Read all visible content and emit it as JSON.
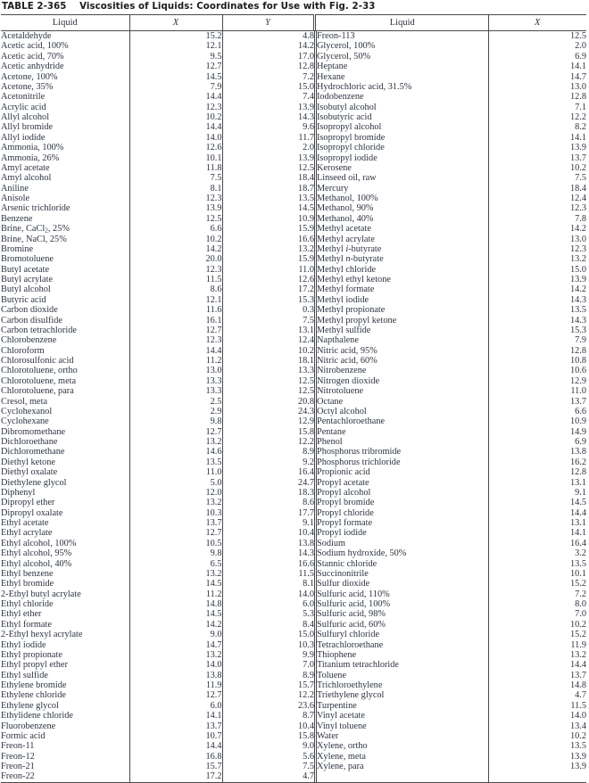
{
  "title": {
    "label": "TABLE 2-365",
    "text": "Viscosities of Liquids: Coordinates for Use with Fig. 2-33"
  },
  "headers": {
    "liquid": "Liquid",
    "x": "X",
    "y": "Y",
    "liquid2": "Liquid",
    "x2": "X"
  },
  "left_rows": [
    {
      "name": "Acetaldehyde",
      "x": "15.2",
      "y": "4.8"
    },
    {
      "name": "Acetic acid, 100%",
      "x": "12.1",
      "y": "14.2"
    },
    {
      "name": "Acetic acid, 70%",
      "x": "9.5",
      "y": "17.0"
    },
    {
      "name": "Acetic anhydride",
      "x": "12.7",
      "y": "12.8"
    },
    {
      "name": "Acetone, 100%",
      "x": "14.5",
      "y": "7.2"
    },
    {
      "name": "Acetone, 35%",
      "x": "7.9",
      "y": "15.0"
    },
    {
      "name": "Acetonitrile",
      "x": "14.4",
      "y": "7.4"
    },
    {
      "name": "Acrylic acid",
      "x": "12.3",
      "y": "13.9"
    },
    {
      "name": "Allyl alcohol",
      "x": "10.2",
      "y": "14.3"
    },
    {
      "name": "Allyl bromide",
      "x": "14.4",
      "y": "9.6"
    },
    {
      "name": "Allyl iodide",
      "x": "14.0",
      "y": "11.7"
    },
    {
      "name": "Ammonia, 100%",
      "x": "12.6",
      "y": "2.0"
    },
    {
      "name": "Ammonia, 26%",
      "x": "10.1",
      "y": "13.9"
    },
    {
      "name": "Amyl acetate",
      "x": "11.8",
      "y": "12.5"
    },
    {
      "name": "Amyl alcohol",
      "x": "7.5",
      "y": "18.4"
    },
    {
      "name": "Aniline",
      "x": "8.1",
      "y": "18.7"
    },
    {
      "name": "Anisole",
      "x": "12.3",
      "y": "13.5"
    },
    {
      "name": "Arsenic trichloride",
      "x": "13.9",
      "y": "14.5"
    },
    {
      "name": "Benzene",
      "x": "12.5",
      "y": "10.9"
    },
    {
      "name": "Brine, CaCl<sub>2</sub>, 25%",
      "html": true,
      "x": "6.6",
      "y": "15.9"
    },
    {
      "name": "Brine, NaCl, 25%",
      "x": "10.2",
      "y": "16.6"
    },
    {
      "name": "Bromine",
      "x": "14.2",
      "y": "13.2"
    },
    {
      "name": "Bromotoluene",
      "x": "20.0",
      "y": "15.9"
    },
    {
      "name": "Butyl acetate",
      "x": "12.3",
      "y": "11.0"
    },
    {
      "name": "Butyl acrylate",
      "x": "11.5",
      "y": "12.6"
    },
    {
      "name": "Butyl alcohol",
      "x": "8.6",
      "y": "17.2"
    },
    {
      "name": "Butyric acid",
      "x": "12.1",
      "y": "15.3"
    },
    {
      "name": "Carbon dioxide",
      "x": "11.6",
      "y": "0.3"
    },
    {
      "name": "Carbon disulfide",
      "x": "16.1",
      "y": "7.5"
    },
    {
      "name": "Carbon tetrachloride",
      "x": "12.7",
      "y": "13.1"
    },
    {
      "name": "Chlorobenzene",
      "x": "12.3",
      "y": "12.4"
    },
    {
      "name": "Chloroform",
      "x": "14.4",
      "y": "10.2"
    },
    {
      "name": "Chlorosulfonic acid",
      "x": "11.2",
      "y": "18.1"
    },
    {
      "name": "Chlorotoluene, ortho",
      "x": "13.0",
      "y": "13.3"
    },
    {
      "name": "Chlorotoluene, meta",
      "x": "13.3",
      "y": "12.5"
    },
    {
      "name": "Chlorotoluene, para",
      "x": "13.3",
      "y": "12.5"
    },
    {
      "name": "Cresol, meta",
      "x": "2.5",
      "y": "20.8"
    },
    {
      "name": "Cyclohexanol",
      "x": "2.9",
      "y": "24.3"
    },
    {
      "name": "Cyclohexane",
      "x": "9.8",
      "y": "12.9"
    },
    {
      "name": "Dibromomethane",
      "x": "12.7",
      "y": "15.8"
    },
    {
      "name": "Dichloroethane",
      "x": "13.2",
      "y": "12.2"
    },
    {
      "name": "Dichloromethane",
      "x": "14.6",
      "y": "8.9"
    },
    {
      "name": "Diethyl ketone",
      "x": "13.5",
      "y": "9.2"
    },
    {
      "name": "Diethyl oxalate",
      "x": "11.0",
      "y": "16.4"
    },
    {
      "name": "Diethylene glycol",
      "x": "5.0",
      "y": "24.7"
    },
    {
      "name": "Diphenyl",
      "x": "12.0",
      "y": "18.3"
    },
    {
      "name": "Dipropyl ether",
      "x": "13.2",
      "y": "8.6"
    },
    {
      "name": "Dipropyl oxalate",
      "x": "10.3",
      "y": "17.7"
    },
    {
      "name": "Ethyl acetate",
      "x": "13.7",
      "y": "9.1"
    },
    {
      "name": "Ethyl acrylate",
      "x": "12.7",
      "y": "10.4"
    },
    {
      "name": "Ethyl alcohol, 100%",
      "x": "10.5",
      "y": "13.8"
    },
    {
      "name": "Ethyl alcohol, 95%",
      "x": "9.8",
      "y": "14.3"
    },
    {
      "name": "Ethyl alcohol, 40%",
      "x": "6.5",
      "y": "16.6"
    },
    {
      "name": "Ethyl benzene",
      "x": "13.2",
      "y": "11.5"
    },
    {
      "name": "Ethyl bromide",
      "x": "14.5",
      "y": "8.1"
    },
    {
      "name": "2-Ethyl butyl acrylate",
      "x": "11.2",
      "y": "14.0"
    },
    {
      "name": "Ethyl chloride",
      "x": "14.8",
      "y": "6.0"
    },
    {
      "name": "Ethyl ether",
      "x": "14.5",
      "y": "5.3"
    },
    {
      "name": "Ethyl formate",
      "x": "14.2",
      "y": "8.4"
    },
    {
      "name": "2-Ethyl hexyl acrylate",
      "x": "9.0",
      "y": "15.0"
    },
    {
      "name": "Ethyl iodide",
      "x": "14.7",
      "y": "10.3"
    },
    {
      "name": "Ethyl propionate",
      "x": "13.2",
      "y": "9.9"
    },
    {
      "name": "Ethyl propyl ether",
      "x": "14.0",
      "y": "7.0"
    },
    {
      "name": "Ethyl sulfide",
      "x": "13.8",
      "y": "8.9"
    },
    {
      "name": "Ethylene bromide",
      "x": "11.9",
      "y": "15.7"
    },
    {
      "name": "Ethylene chloride",
      "x": "12.7",
      "y": "12.2"
    },
    {
      "name": "Ethylene glycol",
      "x": "6.0",
      "y": "23.6"
    },
    {
      "name": "Ethylidene chloride",
      "x": "14.1",
      "y": "8.7"
    },
    {
      "name": "Fluorobenzene",
      "x": "13.7",
      "y": "10.4"
    },
    {
      "name": "Formic acid",
      "x": "10.7",
      "y": "15.8"
    },
    {
      "name": "Freon-11",
      "x": "14.4",
      "y": "9.0"
    },
    {
      "name": "Freon-12",
      "x": "16.8",
      "y": "5.6"
    },
    {
      "name": "Freon-21",
      "x": "15.7",
      "y": "7.5"
    },
    {
      "name": "Freon-22",
      "x": "17.2",
      "y": "4.7"
    }
  ],
  "right_rows": [
    {
      "name": "Freon-113",
      "x": "12.5"
    },
    {
      "name": "Glycerol, 100%",
      "x": "2.0"
    },
    {
      "name": "Glycerol, 50%",
      "x": "6.9"
    },
    {
      "name": "Heptane",
      "x": "14.1"
    },
    {
      "name": "Hexane",
      "x": "14.7"
    },
    {
      "name": "Hydrochloric acid, 31.5%",
      "x": "13.0"
    },
    {
      "name": "Iodobenzene",
      "x": "12.8"
    },
    {
      "name": "Isobutyl alcohol",
      "x": "7.1"
    },
    {
      "name": "Isobutyric acid",
      "x": "12.2"
    },
    {
      "name": "Isopropyl alcohol",
      "x": "8.2"
    },
    {
      "name": "Isopropyl bromide",
      "x": "14.1"
    },
    {
      "name": "Isopropyl chloride",
      "x": "13.9"
    },
    {
      "name": "Isopropyl iodide",
      "x": "13.7"
    },
    {
      "name": "Kerosene",
      "x": "10.2"
    },
    {
      "name": "Linseed oil, raw",
      "x": "7.5"
    },
    {
      "name": "Mercury",
      "x": "18.4"
    },
    {
      "name": "Methanol, 100%",
      "x": "12.4"
    },
    {
      "name": "Methanol, 90%",
      "x": "12.3"
    },
    {
      "name": "Methanol, 40%",
      "x": "7.8"
    },
    {
      "name": "Methyl acetate",
      "x": "14.2"
    },
    {
      "name": "Methyl acrylate",
      "x": "13.0"
    },
    {
      "name": "Methyl <i>i</i>-butyrate",
      "html": true,
      "x": "12.3"
    },
    {
      "name": "Methyl <i>n</i>-butyrate",
      "html": true,
      "x": "13.2"
    },
    {
      "name": "Methyl chloride",
      "x": "15.0"
    },
    {
      "name": "Methyl ethyl ketone",
      "x": "13.9"
    },
    {
      "name": "Methyl formate",
      "x": "14.2"
    },
    {
      "name": "Methyl iodide",
      "x": "14.3"
    },
    {
      "name": "Methyl propionate",
      "x": "13.5"
    },
    {
      "name": "Methyl propyl ketone",
      "x": "14.3"
    },
    {
      "name": "Methyl sulfide",
      "x": "15.3"
    },
    {
      "name": "Napthalene",
      "x": "7.9"
    },
    {
      "name": "Nitric acid, 95%",
      "x": "12.8"
    },
    {
      "name": "Nitric acid, 60%",
      "x": "10.8"
    },
    {
      "name": "Nitrobenzene",
      "x": "10.6"
    },
    {
      "name": "Nitrogen dioxide",
      "x": "12.9"
    },
    {
      "name": "Nitrotoluene",
      "x": "11.0"
    },
    {
      "name": "Octane",
      "x": "13.7"
    },
    {
      "name": "Octyl alcohol",
      "x": "6.6"
    },
    {
      "name": "Pentachloroethane",
      "x": "10.9"
    },
    {
      "name": "Pentane",
      "x": "14.9"
    },
    {
      "name": "Phenol",
      "x": "6.9"
    },
    {
      "name": "Phosphorus tribromide",
      "x": "13.8"
    },
    {
      "name": "Phosphorus trichloride",
      "x": "16.2"
    },
    {
      "name": "Propionic acid",
      "x": "12.8"
    },
    {
      "name": "Propyl acetate",
      "x": "13.1"
    },
    {
      "name": "Propyl alcohol",
      "x": "9.1"
    },
    {
      "name": "Propyl bromide",
      "x": "14.5"
    },
    {
      "name": "Propyl chloride",
      "x": "14.4"
    },
    {
      "name": "Propyl formate",
      "x": "13.1"
    },
    {
      "name": "Propyl iodide",
      "x": "14.1"
    },
    {
      "name": "Sodium",
      "x": "16.4"
    },
    {
      "name": "Sodium hydroxide, 50%",
      "x": "3.2"
    },
    {
      "name": "Stannic chloride",
      "x": "13.5"
    },
    {
      "name": "Succinonitrile",
      "x": "10.1"
    },
    {
      "name": "Sulfur dioxide",
      "x": "15.2"
    },
    {
      "name": "Sulfuric acid, 110%",
      "x": "7.2"
    },
    {
      "name": "Sulfuric acid, 100%",
      "x": "8.0"
    },
    {
      "name": "Sulfuric acid, 98%",
      "x": "7.0"
    },
    {
      "name": "Sulfuric acid, 60%",
      "x": "10.2"
    },
    {
      "name": "Sulfuryl chloride",
      "x": "15.2"
    },
    {
      "name": "Tetrachloroethane",
      "x": "11.9"
    },
    {
      "name": "Thiophene",
      "x": "13.2"
    },
    {
      "name": "Titanium tetrachloride",
      "x": "14.4"
    },
    {
      "name": "Toluene",
      "x": "13.7"
    },
    {
      "name": "Trichloroethylene",
      "x": "14.8"
    },
    {
      "name": "Triethylene glycol",
      "x": "4.7"
    },
    {
      "name": "Turpentine",
      "x": "11.5"
    },
    {
      "name": "Vinyl acetate",
      "x": "14.0"
    },
    {
      "name": "Vinyl toluene",
      "x": "13.4"
    },
    {
      "name": "Water",
      "x": "10.2"
    },
    {
      "name": "Xylene, ortho",
      "x": "13.5"
    },
    {
      "name": "Xylene, meta",
      "x": "13.9"
    },
    {
      "name": "Xylene, para",
      "x": "13.9"
    }
  ]
}
